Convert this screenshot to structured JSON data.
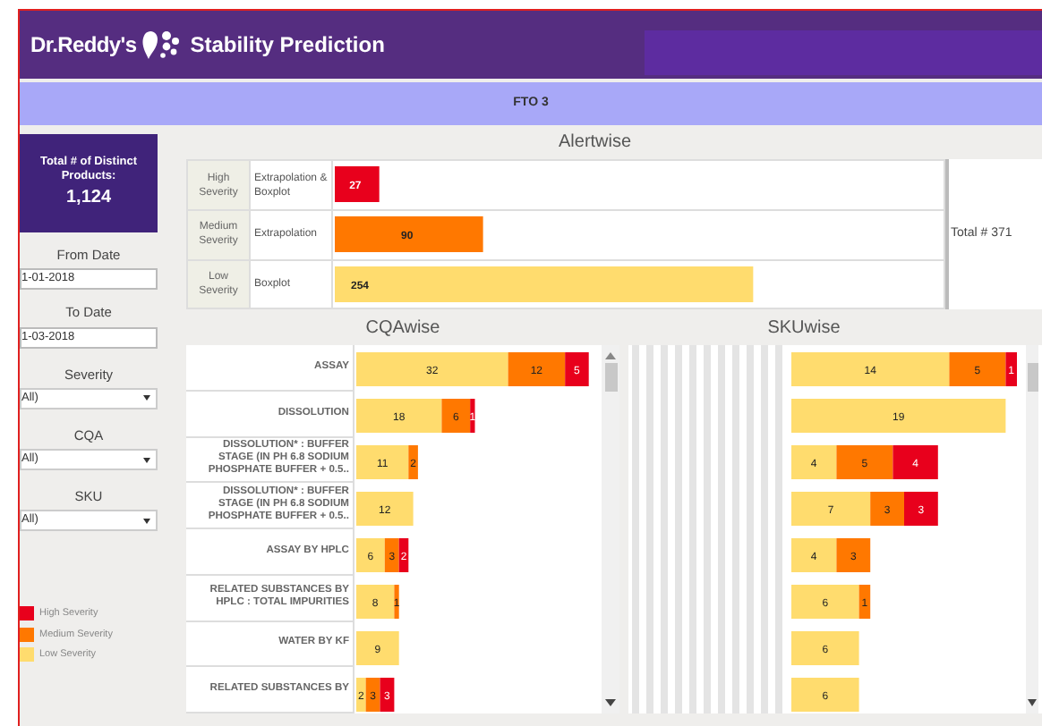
{
  "header": {
    "brand": "Dr.Reddy's",
    "title": "Stability Prediction"
  },
  "banner": {
    "text": "FTO 3"
  },
  "sidebar": {
    "total_label": "Total # of Distinct Products:",
    "total_value": "1,124",
    "filters": [
      {
        "kind": "date",
        "label": "From Date",
        "value": "1-01-2018"
      },
      {
        "kind": "date",
        "label": "To Date",
        "value": "1-03-2018"
      },
      {
        "kind": "select",
        "label": "Severity",
        "value": "All)"
      },
      {
        "kind": "select",
        "label": "CQA",
        "value": "All)"
      },
      {
        "kind": "select",
        "label": "SKU",
        "value": "All)"
      }
    ],
    "legend": [
      {
        "label": "High Severity",
        "color": "#e8001c"
      },
      {
        "label": "Medium Severity",
        "color": "#ff7800"
      },
      {
        "label": "Low Severity",
        "color": "#ffdc6e"
      }
    ]
  },
  "alertwise": {
    "title": "Alertwise",
    "total": "Total # 371",
    "rows": [
      {
        "method": "Extrapolation & Boxplot",
        "color": "#e8001c"
      },
      {
        "method": "Extrapolation",
        "color": "#ff7800"
      },
      {
        "method": "Boxplot",
        "color": "#ffdc6e"
      }
    ],
    "chart_data": {
      "type": "bar",
      "orientation": "horizontal",
      "grid": true,
      "data_labels": true,
      "categories": [
        "High Severity",
        "Medium Severity",
        "Low Severity"
      ],
      "values": [
        27,
        90,
        254
      ]
    }
  },
  "cqawise": {
    "title": "CQAwise",
    "chart_data": {
      "type": "bar",
      "orientation": "horizontal",
      "stacked": true,
      "data_labels": true,
      "categories": [
        "ASSAY",
        "DISSOLUTION",
        "DISSOLUTION* : BUFFER STAGE (IN PH 6.8 SODIUM PHOSPHATE BUFFER + 0.5..",
        "DISSOLUTION* : BUFFER STAGE (IN PH 6.8 SODIUM PHOSPHATE BUFFER + 0.5..",
        "ASSAY BY HPLC",
        "RELATED SUBSTANCES BY HPLC : TOTAL IMPURITIES",
        "WATER BY KF",
        "RELATED SUBSTANCES BY"
      ],
      "series": [
        {
          "color": "#ffdc6e",
          "values": [
            32,
            18,
            11,
            12,
            6,
            8,
            9,
            2
          ]
        },
        {
          "color": "#ff7800",
          "values": [
            12,
            6,
            2,
            null,
            3,
            1,
            null,
            3
          ]
        },
        {
          "color": "#e8001c",
          "values": [
            5,
            1,
            null,
            null,
            2,
            null,
            null,
            3
          ]
        }
      ]
    }
  },
  "skuwise": {
    "title": "SKUwise",
    "chart_data": {
      "type": "bar",
      "orientation": "horizontal",
      "stacked": true,
      "data_labels": true,
      "categories": [
        null,
        null,
        null,
        null,
        null,
        null,
        null,
        null
      ],
      "series": [
        {
          "color": "#ffdc6e",
          "values": [
            14,
            19,
            4,
            7,
            4,
            6,
            6,
            6
          ]
        },
        {
          "color": "#ff7800",
          "values": [
            5,
            null,
            5,
            3,
            3,
            1,
            null,
            null
          ]
        },
        {
          "color": "#e8001c",
          "values": [
            1,
            null,
            4,
            3,
            null,
            null,
            null,
            null
          ]
        }
      ]
    }
  }
}
